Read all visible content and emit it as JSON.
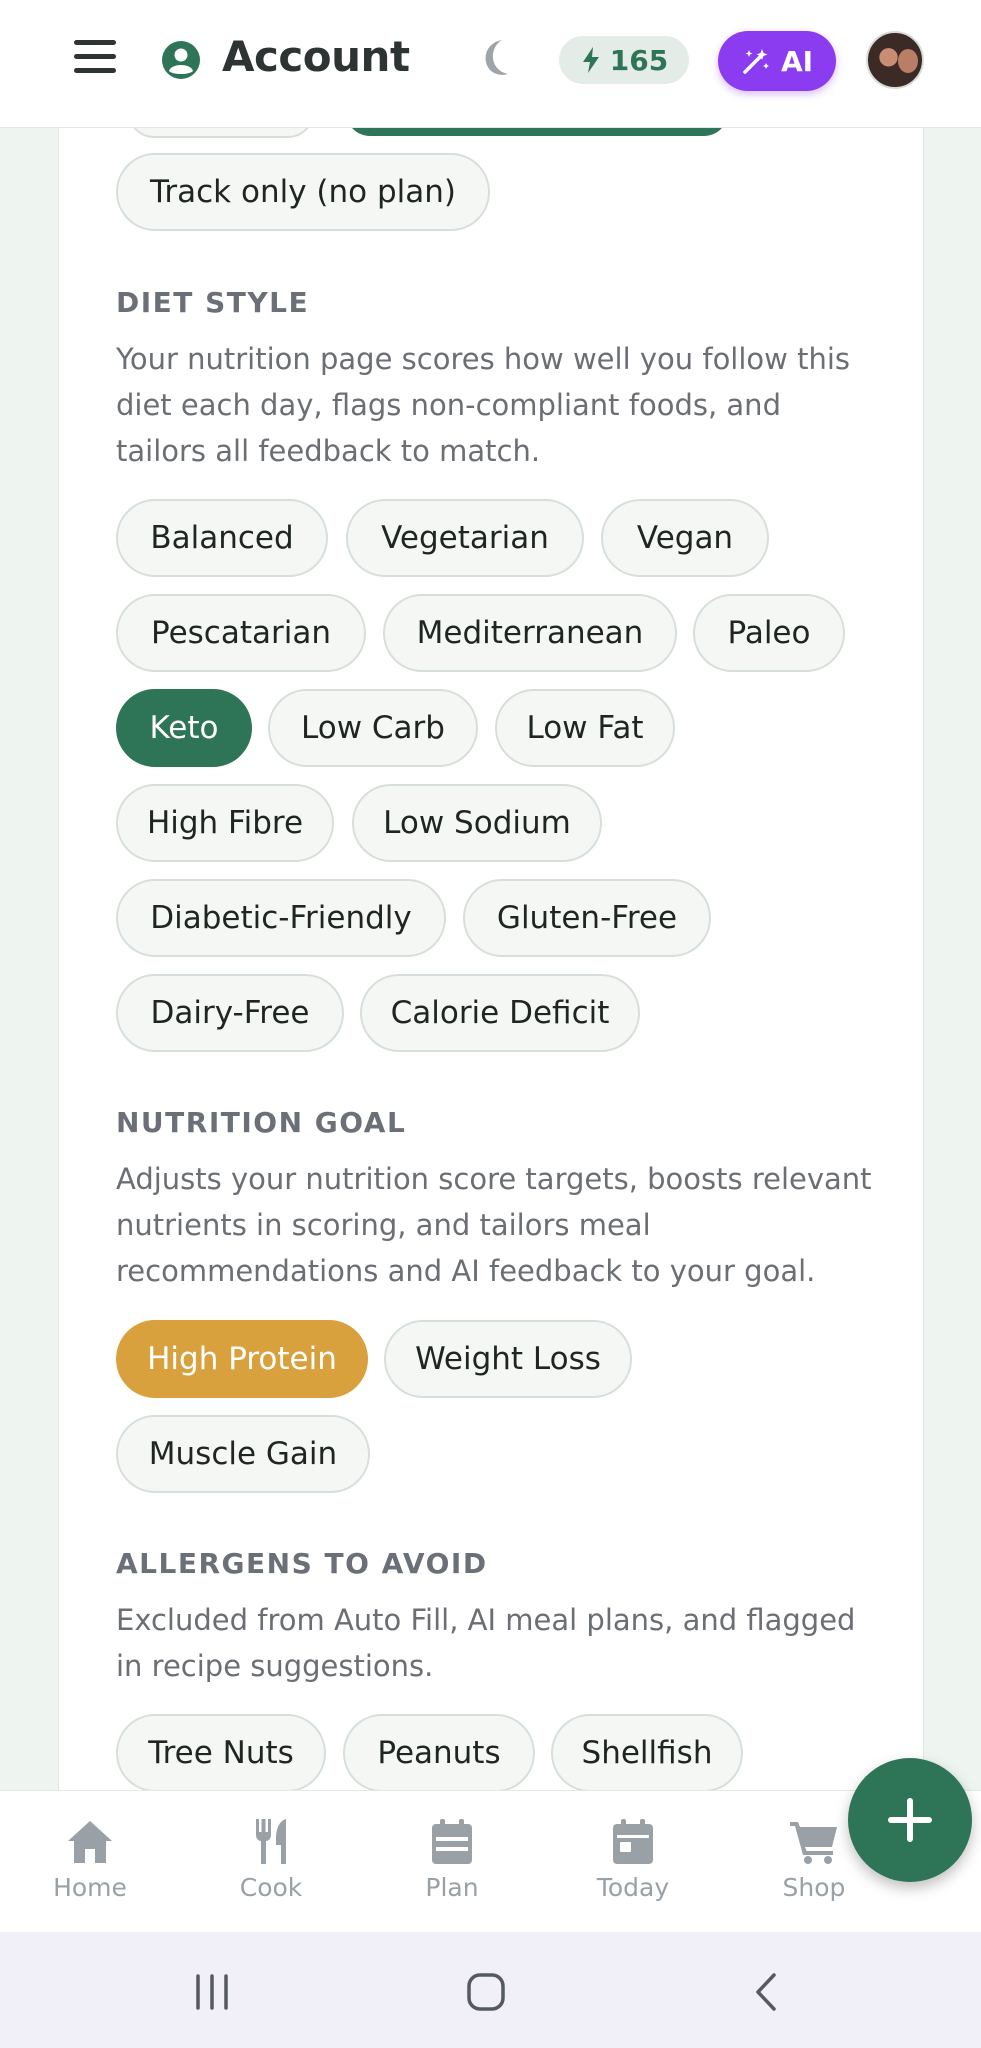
{
  "header": {
    "title": "Account",
    "energy_count": "165",
    "ai_label": "AI"
  },
  "plan_mode": {
    "track_only_label": "Track only (no plan)"
  },
  "diet_style": {
    "heading": "DIET STYLE",
    "description": "Your nutrition page scores how well you follow this diet each day, flags non-compliant foods, and tailors all feedback to match.",
    "options": [
      "Balanced",
      "Vegetarian",
      "Vegan",
      "Pescatarian",
      "Mediterranean",
      "Paleo",
      "Keto",
      "Low Carb",
      "Low Fat",
      "High Fibre",
      "Low Sodium",
      "Diabetic-Friendly",
      "Gluten-Free",
      "Dairy-Free",
      "Calorie Deficit"
    ],
    "selected": "Keto"
  },
  "nutrition_goal": {
    "heading": "NUTRITION GOAL",
    "description": "Adjusts your nutrition score targets, boosts relevant nutrients in scoring, and tailors meal recommendations and AI feedback to your goal.",
    "options": [
      "High Protein",
      "Weight Loss",
      "Muscle Gain"
    ],
    "selected": "High Protein"
  },
  "allergens": {
    "heading": "ALLERGENS TO AVOID",
    "description": "Excluded from Auto Fill, AI meal plans, and flagged in recipe suggestions.",
    "options": [
      "Tree Nuts",
      "Peanuts",
      "Shellfish"
    ]
  },
  "bottom_nav": {
    "items": [
      "Home",
      "Cook",
      "Plan",
      "Today",
      "Shop"
    ]
  },
  "colors": {
    "primary_green": "#2e7456",
    "gold": "#d9a13e",
    "ai_purple": "#8b3bf0"
  }
}
